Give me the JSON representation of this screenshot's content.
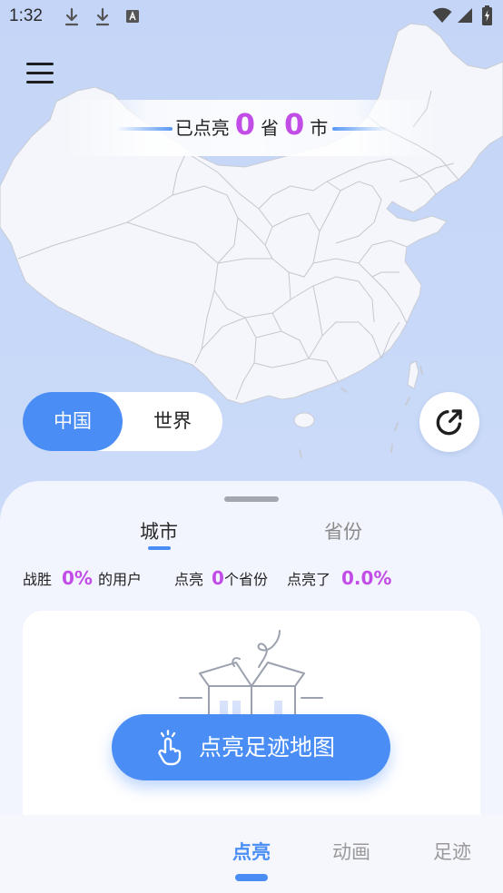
{
  "status_bar": {
    "time": "1:32",
    "icons": [
      "download-icon",
      "download-icon",
      "a-text-icon",
      "wifi-icon",
      "signal-icon",
      "battery-icon"
    ]
  },
  "header": {
    "menu_icon": "menu-icon"
  },
  "banner": {
    "prefix": "已点亮",
    "province_count": "0",
    "province_unit": "省",
    "city_count": "0",
    "city_unit": "市"
  },
  "map_toggle": {
    "options": [
      "中国",
      "世界"
    ],
    "selected_index": 0
  },
  "share_icon": "share-icon",
  "sheet": {
    "tabs": [
      {
        "label": "城市",
        "selected": true
      },
      {
        "label": "省份",
        "selected": false
      }
    ],
    "stats": {
      "beat_prefix": "战胜",
      "beat_value": "0%",
      "beat_suffix": "的用户",
      "lit_prefix": "点亮",
      "lit_value": "0",
      "lit_suffix": "个省份",
      "lit_pct_prefix": "点亮了",
      "lit_pct_value": "0.0%"
    },
    "empty_card": {
      "illustration": "empty-box-illustration",
      "action_icon": "tap-hand-icon",
      "action_label": "点亮足迹地图"
    }
  },
  "bottom_nav": {
    "items": [
      {
        "label": "点亮",
        "selected": true
      },
      {
        "label": "动画",
        "selected": false
      },
      {
        "label": "足迹",
        "selected": false
      }
    ]
  },
  "colors": {
    "accent": "#4a8ef5",
    "highlight": "#c24de6",
    "map_background": "#c9d9f8",
    "map_fill": "#f4f6fb"
  }
}
